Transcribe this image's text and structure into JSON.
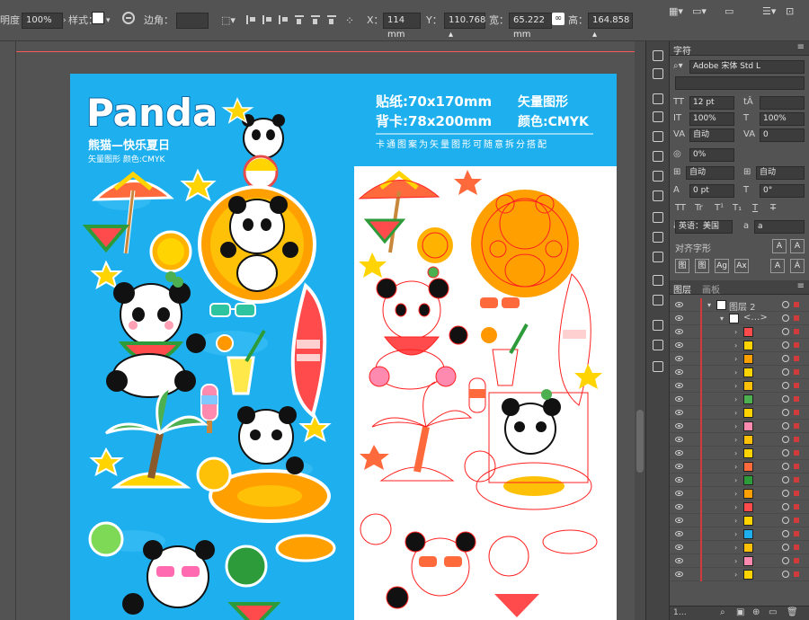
{
  "control_bar": {
    "opacity_label": "明度：",
    "opacity_value": "100%",
    "style_label": "样式：",
    "corner_label": "边角：",
    "x_label": "X：",
    "x_value": "114 mm",
    "y_label": "Y：",
    "y_value": "110.768 ▴",
    "w_label": "宽：",
    "w_value": "65.222 mm",
    "h_label": "高：",
    "h_value": "164.858 ▴"
  },
  "artwork": {
    "title": "Panda",
    "subtitle_cn": "熊猫—快乐夏日",
    "subtitle_small": "矢量图形  颜色:CMYK",
    "spec_line1": "贴纸:70x170mm",
    "spec_line1_right": "矢量图形",
    "spec_line2": "背卡:78x200mm",
    "spec_line2_right": "颜色:CMYK",
    "spec_line3": "卡通图案为矢量图形可随意拆分搭配"
  },
  "char_panel": {
    "tab": "字符",
    "font_family": "Adobe 宋体 Std L",
    "font_size": "12 pt",
    "leading": "自动",
    "tracking": "0%",
    "kerning": "0",
    "h_scale": "100%",
    "v_scale": "100%",
    "baseline": "0 pt",
    "rotation": "0°",
    "auto_left": "自动",
    "auto_right": "自动",
    "tt_buttons": [
      "TT",
      "Tr",
      "T¹",
      "T₁",
      "T",
      "T"
    ],
    "language_label": "英语：美国",
    "aa_label": "a",
    "aa_value": "a",
    "glyph_section": "对齐字形",
    "align_buttons": [
      "图",
      "图",
      "Ag",
      "Ax",
      "A",
      "Á"
    ]
  },
  "layers_panel": {
    "tab_layers": "图层",
    "tab_artboards": "画板",
    "layer_name": "图层 2",
    "sublayer_name": "<…>",
    "footer_count": "1…"
  },
  "colors": {
    "artboard_blue": "#1eb0ee",
    "artwork_yellow": "#ffd400",
    "outline_red": "#ff2020",
    "ui_gray": "#535353",
    "ui_dark": "#434343"
  }
}
